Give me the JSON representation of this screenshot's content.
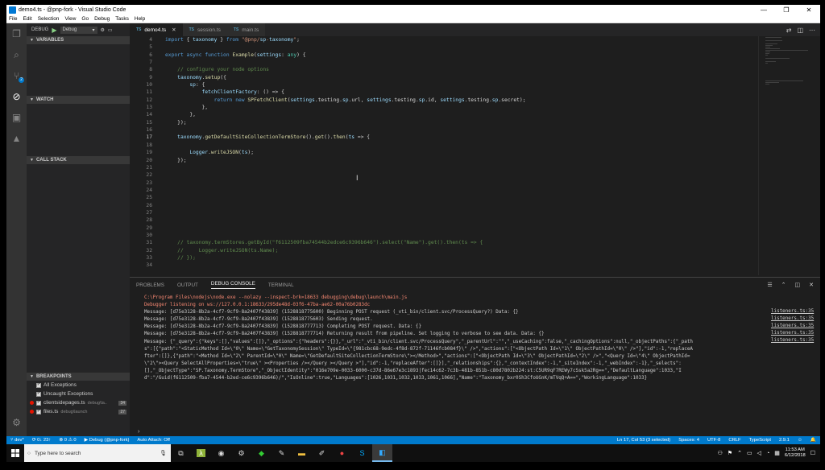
{
  "window": {
    "title": "demo4.ts - @pnp-fork - Visual Studio Code",
    "controls": [
      "—",
      "❐",
      "✕"
    ]
  },
  "menu": [
    "File",
    "Edit",
    "Selection",
    "View",
    "Go",
    "Debug",
    "Tasks",
    "Help"
  ],
  "activity_bar": {
    "items": [
      {
        "name": "explorer-icon",
        "glyph": "❐"
      },
      {
        "name": "search-icon",
        "glyph": "⌕"
      },
      {
        "name": "source-control-icon",
        "glyph": "⑂",
        "badge": "2"
      },
      {
        "name": "debug-icon",
        "glyph": "⊘"
      },
      {
        "name": "extensions-icon",
        "glyph": "▣"
      },
      {
        "name": "azure-icon",
        "glyph": "▲"
      }
    ],
    "settings_glyph": "⚙"
  },
  "sidebar": {
    "debug_label": "DEBUG",
    "debug_config": "Debug",
    "sections": {
      "variables": "VARIABLES",
      "watch": "WATCH",
      "call_stack": "CALL STACK",
      "breakpoints": "BREAKPOINTS"
    },
    "breakpoints": [
      {
        "label": "All Exceptions",
        "checked": true,
        "dot": false,
        "path": "",
        "line": ""
      },
      {
        "label": "Uncaught Exceptions",
        "checked": true,
        "dot": false,
        "path": "",
        "line": ""
      },
      {
        "label": "clientsidepages.ts",
        "checked": true,
        "dot": true,
        "path": "debug\\la..",
        "line": "34"
      },
      {
        "label": "files.ts",
        "checked": true,
        "dot": true,
        "path": "debug\\launch",
        "line": "27"
      }
    ]
  },
  "tabs": [
    {
      "label": "demo4.ts",
      "active": true,
      "lang": "TS"
    },
    {
      "label": "session.ts",
      "active": false,
      "lang": "TS"
    },
    {
      "label": "main.ts",
      "active": false,
      "lang": "TS"
    }
  ],
  "editor": {
    "first_line": 4,
    "current_line": 17,
    "lines": [
      "import { taxonomy } from \"@pnp/sp-taxonomy\";",
      "",
      "export async function Example(settings: any) {",
      "",
      "    // configure your node options",
      "    taxonomy.setup({",
      "        sp: {",
      "            fetchClientFactory: () => {",
      "                return new SPFetchClient(settings.testing.sp.url, settings.testing.sp.id, settings.testing.sp.secret);",
      "            },",
      "        },",
      "    });",
      "",
      "    taxonomy.getDefaultSiteCollectionTermStore().get().then(ts => {",
      "",
      "        Logger.writeJSON(ts);",
      "    });",
      "",
      "",
      "",
      "",
      "",
      "",
      "",
      "",
      "",
      "",
      "    // taxonomy.termStores.getById(\"f6112509fba74544b2edce6c9396b646\").select(\"Name\").get().then(ts => {",
      "    //     Logger.writeJSON(ts.Name);",
      "    // });",
      ""
    ]
  },
  "panel": {
    "tabs": [
      {
        "label": "PROBLEMS",
        "active": false
      },
      {
        "label": "OUTPUT",
        "active": false
      },
      {
        "label": "DEBUG CONSOLE",
        "active": true
      },
      {
        "label": "TERMINAL",
        "active": false
      }
    ],
    "console_lines": [
      {
        "text": "C:\\Program Files\\nodejs\\node.exe --nolazy --inspect-brk=18633 debugging\\debug\\launch\\main.js",
        "kind": "err"
      },
      {
        "text": "Debugger listening on ws://127.0.0.1:18633/295de48d-03f6-47ba-ae62-00a76b0283dc",
        "kind": "err"
      },
      {
        "text": "Message: [d75e3128-8b2a-4cf7-9cf9-8a2407f43839] (1528818775600) Beginning POST request (_vti_bin/client.svc/ProcessQuery?) Data: {}",
        "kind": "out"
      },
      {
        "text": "Message: [d75e3128-8b2a-4cf7-9cf9-8a2407f43839] (1528818775603) Sending request.",
        "kind": "out"
      },
      {
        "text": "Message: [d75e3128-8b2a-4cf7-9cf9-8a2407f43839] (1528818777713) Completing POST request. Data: {}",
        "kind": "out"
      },
      {
        "text": "Message: [d75e3128-8b2a-4cf7-9cf9-8a2407f43839] (1528818777714) Returning result from pipeline. Set logging to verbose to see data. Data: {}",
        "kind": "out"
      },
      {
        "text": "Message: {\"_query\":{\"keys\":[],\"values\":[]},\"_options\":{\"headers\":{}},\"_url\":\"_vti_bin/client.svc/ProcessQuery\",\"_parentUrl\":\"\",\"_useCaching\":false,\"_cachingOptions\":null,\"_objectPaths\":{\"_path",
        "kind": "out"
      },
      {
        "text": "s\":[{\"path\":\"<StaticMethod Id=\\\"0\\\" Name=\\\"GetTaxonomySession\\\" TypeId=\\\"{981cbc68-9edc-4f8d-872f-71146fcb084f}\\\" />\",\"actions\":[\"<ObjectPath Id=\\\"1\\\" ObjectPathId=\\\"0\\\" />\"],\"id\":-1,\"replaceA",
        "kind": "out"
      },
      {
        "text": "fter\":[]},{\"path\":\"<Method Id=\\\"2\\\" ParentId=\\\"0\\\" Name=\\\"GetDefaultSiteCollectionTermStore\\\"></Method>\",\"actions\":[\"<ObjectPath Id=\\\"3\\\" ObjectPathId=\\\"2\\\" />\",\"<Query Id=\\\"4\\\" ObjectPathId=",
        "kind": "out"
      },
      {
        "text": "\\\"2\\\"><Query SelectAllProperties=\\\"true\\\" ><Properties /></Query ></Query >\"],\"id\":-1,\"replaceAfter\":[]}],\"_relationships\":{},\"_contextIndex\":-1,\"_siteIndex\":-1,\"_webIndex\":-1},\"_selects\":",
        "kind": "out"
      },
      {
        "text": "[],\"_ObjectType\":\"SP.Taxonomy.TermStore\",\"_ObjectIdentity\":\"016e709e-0033-6000-c37d-86e67e3c1893|fec14c62-7c3b-481b-851b-c80d7802b224:st:C5UR9qF7REWy7cSsk5a2Rg==\",\"DefaultLanguage\":1033,\"I",
        "kind": "out"
      },
      {
        "text": "d\":\"/Guid(f6112509-fba7-4544-b2ed-ce6c9396b646)/\",\"IsOnline\":true,\"Languages\":[1026,1031,1032,1033,1061,1066],\"Name\":\"Taxonomy_bxr0Sh3CfoUGnK/mTVqQ+A==\",\"WorkingLanguage\":1033}",
        "kind": "out"
      }
    ],
    "source_links": [
      "listeners.ts:35",
      "listeners.ts:35",
      "listeners.ts:35",
      "listeners.ts:35",
      "listeners.ts:35"
    ],
    "prompt": "›"
  },
  "status_bar": {
    "branch": "dev*",
    "sync": "0↓ 23↑",
    "errors": "0",
    "warnings": "0",
    "debug": "Debug (@pnp-fork)",
    "auto_attach": "Auto Attach: Off",
    "position": "Ln 17, Col 53 (3 selected)",
    "spaces": "Spaces: 4",
    "encoding": "UTF-8",
    "eol": "CRLF",
    "language": "TypeScript",
    "version": "2.9.1"
  },
  "taskbar": {
    "search_placeholder": "Type here to search",
    "time": "11:53 AM",
    "date": "6/12/2018"
  }
}
